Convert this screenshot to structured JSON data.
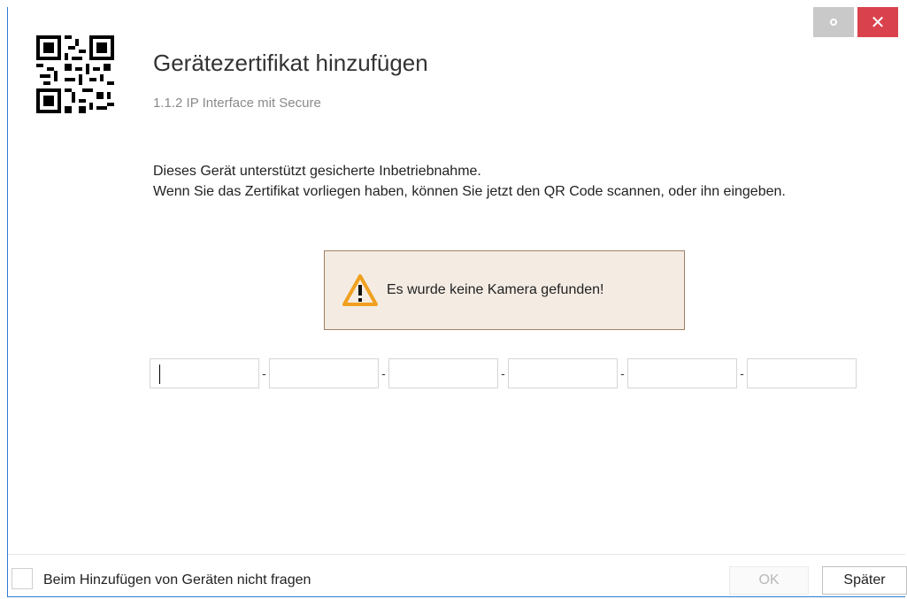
{
  "window": {
    "title": "Gerätezertifikat hinzufügen",
    "subtitle": "1.1.2 IP Interface mit Secure",
    "icon": "qr-code-icon",
    "close_glyph": "✕"
  },
  "description": {
    "line1": "Dieses Gerät unterstützt gesicherte Inbetriebnahme.",
    "line2": "Wenn Sie das Zertifikat vorliegen haben, können Sie jetzt den QR Code scannen, oder ihn eingeben."
  },
  "warning": {
    "icon": "warning-icon",
    "text": "Es wurde keine Kamera gefunden!"
  },
  "certificate_fields": {
    "separator": "-",
    "values": [
      "",
      "",
      "",
      "",
      "",
      ""
    ]
  },
  "footer": {
    "checkbox_label": "Beim Hinzufügen von Geräten nicht fragen",
    "checkbox_checked": false,
    "ok_label": "OK",
    "later_label": "Später"
  }
}
